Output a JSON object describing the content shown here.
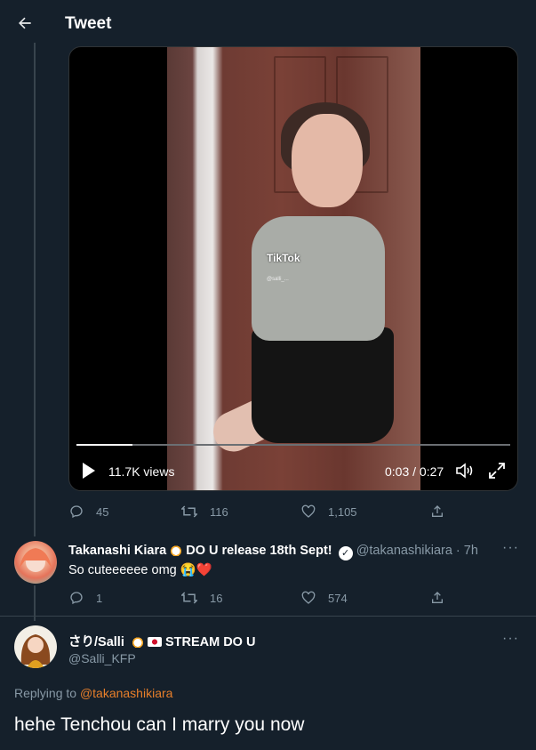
{
  "header": {
    "title": "Tweet",
    "back_icon": "arrow-left-icon"
  },
  "video": {
    "views": "11.7K views",
    "time": "0:03 / 0:27",
    "progress_fraction": 0.13,
    "watermark": {
      "brand": "TikTok",
      "handle": "@salli_..."
    }
  },
  "main_tweet_actions": {
    "replies": "45",
    "retweets": "116",
    "likes": "1,105"
  },
  "reply_tweet": {
    "name": "Takanashi Kiara",
    "name_suffix": "DO U release 18th Sept!",
    "handle_time": "@takanashikiara · 7h",
    "text": "So cuteeeeee omg",
    "emoji": "😭❤️",
    "actions": {
      "replies": "1",
      "retweets": "16",
      "likes": "574"
    }
  },
  "focused_tweet": {
    "name": "さり/Salli",
    "name_suffix": "STREAM DO U",
    "handle": "@Salli_KFP",
    "replying_label": "Replying to",
    "replying_to": "@takanashikiara",
    "text": "hehe Tenchou can I marry you now"
  },
  "colors": {
    "background": "#15202b",
    "muted": "#8899a6",
    "link": "#e87f2a",
    "divider": "#38444d"
  }
}
